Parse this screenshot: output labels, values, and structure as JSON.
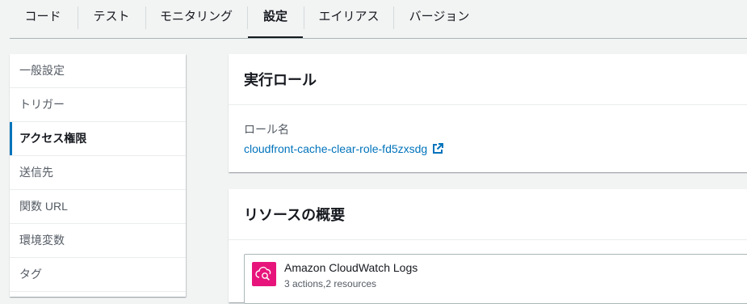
{
  "tabs": [
    {
      "label": "コード"
    },
    {
      "label": "テスト"
    },
    {
      "label": "モニタリング"
    },
    {
      "label": "設定",
      "active": true
    },
    {
      "label": "エイリアス"
    },
    {
      "label": "バージョン"
    }
  ],
  "sidenav": {
    "items": [
      {
        "label": "一般設定"
      },
      {
        "label": "トリガー"
      },
      {
        "label": "アクセス権限",
        "active": true
      },
      {
        "label": "送信先"
      },
      {
        "label": "関数 URL"
      },
      {
        "label": "環境変数"
      },
      {
        "label": "タグ"
      }
    ]
  },
  "execution_role": {
    "title": "実行ロール",
    "role_label": "ロール名",
    "role_name": "cloudfront-cache-clear-role-fd5zxsdg",
    "link_icon": "external-link-icon"
  },
  "resource_summary": {
    "title": "リソースの概要",
    "resources": [
      {
        "name": "Amazon CloudWatch Logs",
        "detail": "3 actions,2 resources",
        "icon": "cloudwatch-logs-icon"
      }
    ]
  },
  "colors": {
    "accent": "#0073bb",
    "cloudwatch": "#e7157b",
    "background": "#f2f3f3"
  }
}
